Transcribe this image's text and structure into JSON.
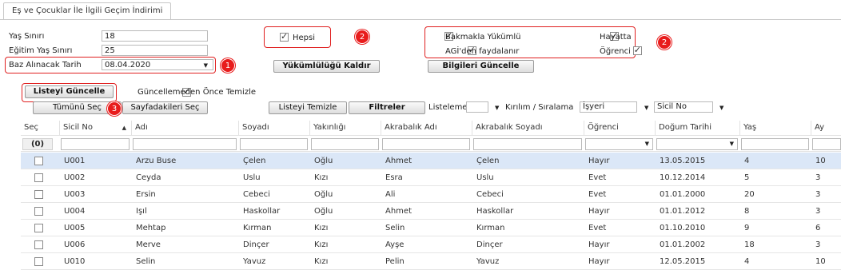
{
  "tab": {
    "title": "Eş ve Çocuklar İle İlgili Geçim İndirimi"
  },
  "form": {
    "yas_siniri_label": "Yaş Sınırı",
    "yas_siniri_value": "18",
    "egitim_yas_label": "Eğitim Yaş Sınırı",
    "egitim_yas_value": "25",
    "baz_tarih_label": "Baz Alınacak Tarih",
    "baz_tarih_value": "08.04.2020",
    "hepsi_label": "Hepsi",
    "bakmakla_label": "Bakmakla Yükümlü",
    "hayatta_label": "Hayatta",
    "agi_label": "AGİ'den faydalanır",
    "ogrenci_label": "Öğrenci",
    "yukumlulugu_kaldir": "Yükümlülüğü Kaldır",
    "bilgileri_guncelle": "Bilgileri Güncelle"
  },
  "toolbar": {
    "listeyi_guncelle": "Listeyi Güncelle",
    "guncellemeden_label": "Güncellemeden Önce Temizle",
    "tumunu_sec": "Tümünü Seç",
    "sayfadakileri_sec": "Sayfadakileri Seç",
    "listeyi_temizle": "Listeyi Temizle",
    "filtreler": "Filtreler",
    "listeleme_label": "Listeleme",
    "kirilim_label": "Kırılım / Sıralama",
    "kirilim_value": "İşyeri",
    "sicil_value": "Sicil No"
  },
  "badges": {
    "b1": "1",
    "b2a": "2",
    "b2b": "2",
    "b3": "3"
  },
  "table": {
    "headers": [
      "Seç",
      "Sicil No",
      "Adı",
      "Soyadı",
      "Yakınlığı",
      "Akrabalık Adı",
      "Akrabalık Soyadı",
      "Öğrenci",
      "Doğum Tarihi",
      "Yaş",
      "Ay"
    ],
    "sel_count": "(0)",
    "rows": [
      {
        "sicil": "U001",
        "adi": "Arzu Buse",
        "soyadi": "Çelen",
        "yakinlik": "Oğlu",
        "akr_adi": "Ahmet",
        "akr_soyadi": "Çelen",
        "ogrenci": "Hayır",
        "dogum": "13.05.2015",
        "yas": "4",
        "ay": "10"
      },
      {
        "sicil": "U002",
        "adi": "Ceyda",
        "soyadi": "Uslu",
        "yakinlik": "Kızı",
        "akr_adi": "Esra",
        "akr_soyadi": "Uslu",
        "ogrenci": "Evet",
        "dogum": "10.12.2014",
        "yas": "5",
        "ay": "3"
      },
      {
        "sicil": "U003",
        "adi": "Ersin",
        "soyadi": "Cebeci",
        "yakinlik": "Oğlu",
        "akr_adi": "Ali",
        "akr_soyadi": "Cebeci",
        "ogrenci": "Evet",
        "dogum": "01.01.2000",
        "yas": "20",
        "ay": "3"
      },
      {
        "sicil": "U004",
        "adi": "Işıl",
        "soyadi": "Haskollar",
        "yakinlik": "Oğlu",
        "akr_adi": "Ahmet",
        "akr_soyadi": "Haskollar",
        "ogrenci": "Hayır",
        "dogum": "01.01.2012",
        "yas": "8",
        "ay": "3"
      },
      {
        "sicil": "U005",
        "adi": "Mehtap",
        "soyadi": "Kırman",
        "yakinlik": "Kızı",
        "akr_adi": "Selin",
        "akr_soyadi": "Kırman",
        "ogrenci": "Evet",
        "dogum": "01.10.2010",
        "yas": "9",
        "ay": "6"
      },
      {
        "sicil": "U006",
        "adi": "Merve",
        "soyadi": "Dinçer",
        "yakinlik": "Kızı",
        "akr_adi": "Ayşe",
        "akr_soyadi": "Dinçer",
        "ogrenci": "Hayır",
        "dogum": "01.01.2002",
        "yas": "18",
        "ay": "3"
      },
      {
        "sicil": "U010",
        "adi": "Selin",
        "soyadi": "Yavuz",
        "yakinlik": "Kızı",
        "akr_adi": "Pelin",
        "akr_soyadi": "Yavuz",
        "ogrenci": "Hayır",
        "dogum": "12.05.2015",
        "yas": "4",
        "ay": "10"
      }
    ]
  }
}
